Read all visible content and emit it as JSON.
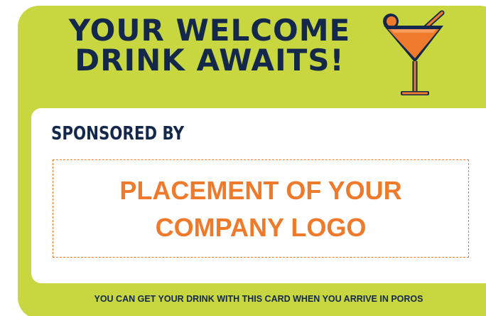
{
  "headline": {
    "line1": "YOUR WELCOME",
    "line2": "DRINK AWAITS!"
  },
  "sponsor": {
    "label": "SPONSORED BY",
    "logo_placeholder_line1": "PLACEMENT OF YOUR",
    "logo_placeholder_line2": "COMPANY LOGO"
  },
  "footer": {
    "note": "YOU CAN GET YOUR DRINK WITH THIS CARD WHEN YOU ARRIVE IN POROS"
  },
  "colors": {
    "card_background": "#c8d63f",
    "navy": "#14284b",
    "accent_orange": "#f07a2b",
    "panel": "#ffffff"
  },
  "icons": {
    "drink": "cocktail-glass-icon"
  }
}
